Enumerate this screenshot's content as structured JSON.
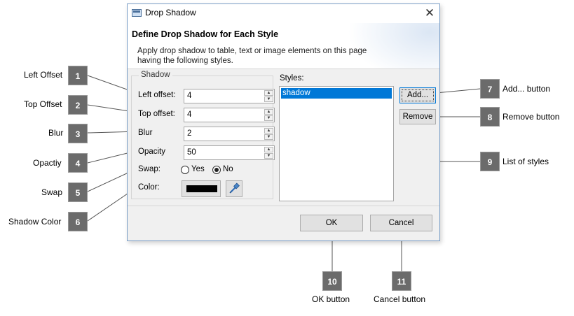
{
  "dialog": {
    "title": "Drop Shadow",
    "close_glyph": "✕",
    "header_title": "Define Drop Shadow for Each Style",
    "header_desc": "Apply drop shadow to table, text or image elements on this page having the following styles.",
    "shadow_group": "Shadow",
    "left_offset_label": "Left offset:",
    "left_offset_value": "4",
    "top_offset_label": "Top offset:",
    "top_offset_value": "4",
    "blur_label": "Blur",
    "blur_value": "2",
    "opacity_label": "Opacity",
    "opacity_value": "50",
    "swap_label": "Swap:",
    "swap_yes": "Yes",
    "swap_no": "No",
    "swap_selected": "No",
    "color_label": "Color:",
    "color_value": "#000000",
    "styles_label": "Styles:",
    "styles": [
      "shadow"
    ],
    "add_button": "Add...",
    "remove_button": "Remove",
    "ok_button": "OK",
    "cancel_button": "Cancel"
  },
  "callouts": [
    {
      "num": "1",
      "text": "Left Offset"
    },
    {
      "num": "2",
      "text": "Top Offset"
    },
    {
      "num": "3",
      "text": "Blur"
    },
    {
      "num": "4",
      "text": "Opactiy"
    },
    {
      "num": "5",
      "text": "Swap"
    },
    {
      "num": "6",
      "text": "Shadow Color"
    },
    {
      "num": "7",
      "text": "Add... button"
    },
    {
      "num": "8",
      "text": "Remove button"
    },
    {
      "num": "9",
      "text": "List of styles"
    },
    {
      "num": "10",
      "text": "OK button"
    },
    {
      "num": "11",
      "text": "Cancel button"
    }
  ],
  "colors": {
    "accent": "#0078d7",
    "badge": "#6b6b6b",
    "dialog_bg": "#f0f0f0"
  },
  "icons": {
    "title": "dialog-icon",
    "close": "close-icon",
    "picker": "eyedropper-icon"
  }
}
